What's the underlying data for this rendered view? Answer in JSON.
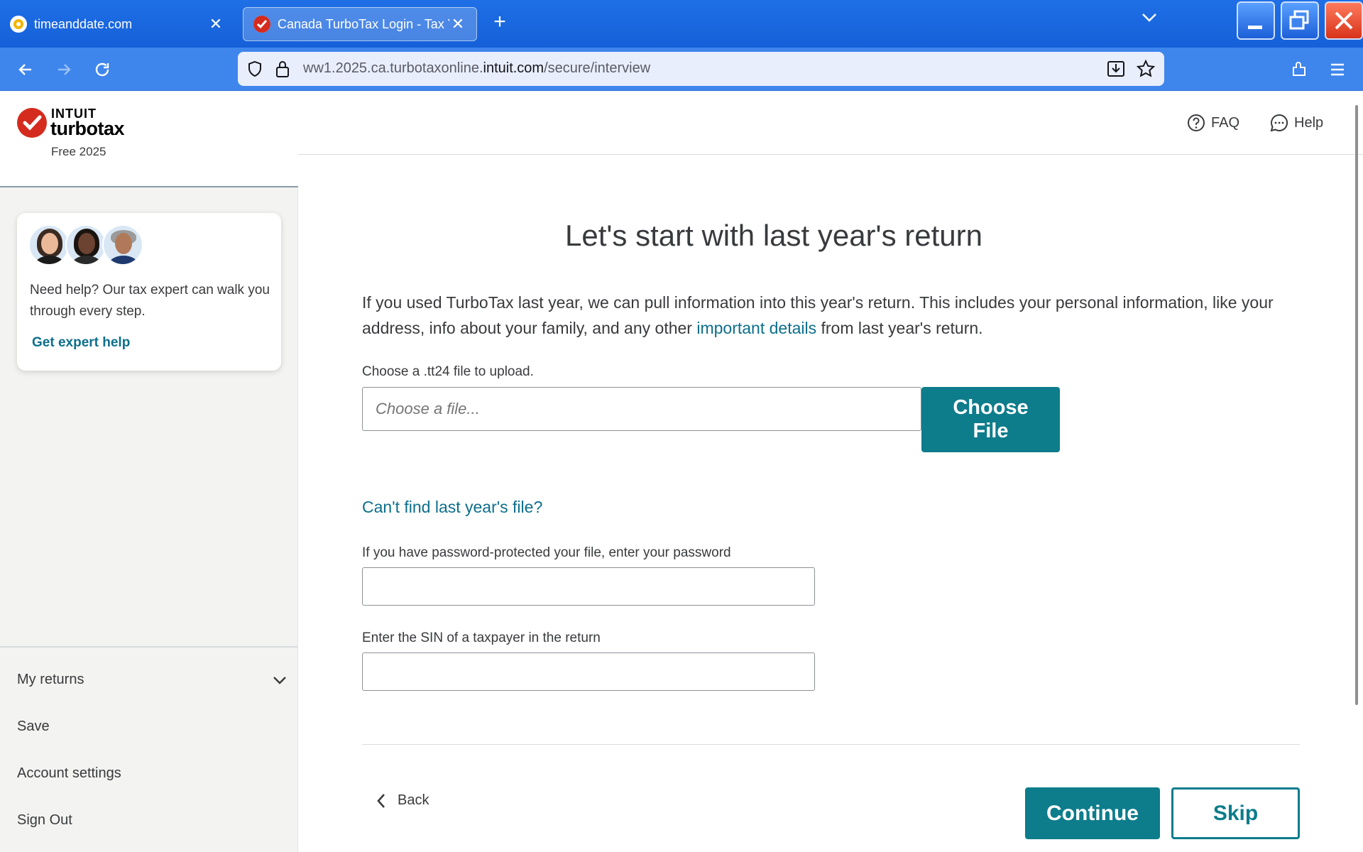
{
  "browser": {
    "tabs": [
      {
        "title": "timeanddate.com",
        "active": false
      },
      {
        "title": "Canada TurboTax Login - Tax Ye",
        "active": true
      }
    ],
    "url": {
      "prefix": "ww1.2025.ca.turbotaxonline.",
      "host": "intuit.com",
      "path": "/secure/interview"
    }
  },
  "brand": {
    "intuit": "INTUIT",
    "product": "turbotax",
    "edition": "Free 2025",
    "accent": "#d52b1e"
  },
  "expert_card": {
    "text": "Need help? Our tax expert can walk you through every step.",
    "link": "Get expert help"
  },
  "sidebar_nav": {
    "my_returns": "My returns",
    "save": "Save",
    "account_settings": "Account settings",
    "sign_out": "Sign Out"
  },
  "topbar": {
    "faq": "FAQ",
    "help": "Help"
  },
  "page": {
    "title": "Let's start with last year's return",
    "intro_before": "If you used TurboTax last year, we can pull information into this year's return. This includes your personal information, like your address, info about your family, and any other ",
    "intro_link": "important details",
    "intro_after": " from last year's return.",
    "file_label": "Choose a .tt24 file to upload.",
    "file_placeholder": "Choose a file...",
    "choose_file": "Choose File",
    "cant_find": "Can't find last year's file?",
    "password_label": "If you have password-protected your file, enter your password",
    "sin_label": "Enter the SIN of a taxpayer in the return"
  },
  "footer": {
    "back": "Back",
    "continue": "Continue",
    "skip": "Skip"
  },
  "colors": {
    "teal": "#0d7c8b",
    "link": "#0d6e8c",
    "browser_blue": "#3e86ec"
  }
}
